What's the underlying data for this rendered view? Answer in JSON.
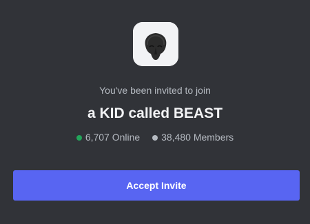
{
  "invite": {
    "intro_text": "You've been invited to join",
    "server_name": "a KID called BEAST",
    "online": {
      "text": "6,707 Online",
      "dot_color": "#23a55a"
    },
    "members": {
      "text": "38,480 Members",
      "dot_color": "#b5bac1"
    },
    "accept_label": "Accept Invite",
    "server_icon": "dark-mask-logo-icon"
  },
  "colors": {
    "background": "#313338",
    "accent": "#5865f2",
    "icon_tile": "#f2f3f5"
  }
}
